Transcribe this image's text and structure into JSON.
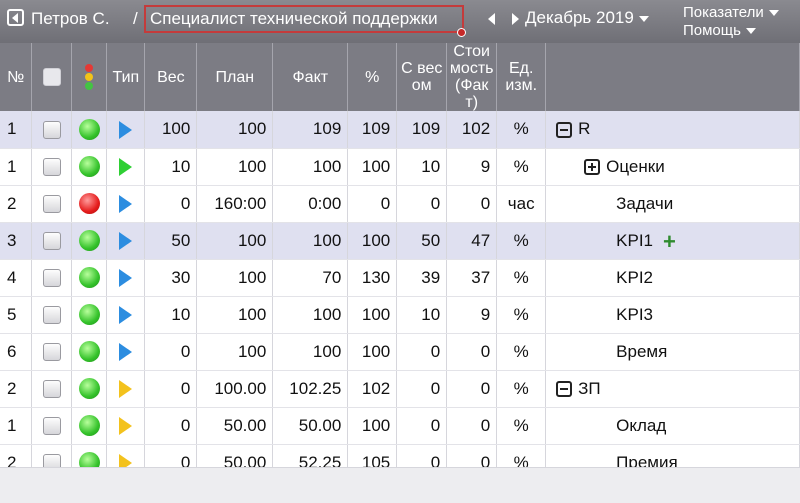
{
  "header": {
    "user": "Петров С.",
    "separator": "/",
    "role": "Специалист технической поддержки",
    "role_badge": "1",
    "period": "Декабрь 2019",
    "menu_indicators": "Показатели",
    "menu_help": "Помощь"
  },
  "columns": {
    "num": "№",
    "type": "Тип",
    "weight": "Вес",
    "plan": "План",
    "fact": "Факт",
    "pct": "%",
    "weighted": "С весом",
    "cost": "Стоимость (Факт)",
    "unit": "Ед. изм."
  },
  "rows": [
    {
      "num": "1",
      "status": "green",
      "type": "blue",
      "weight": "100",
      "plan": "100",
      "fact": "109",
      "pct": "109",
      "weighted": "109",
      "cost": "102",
      "unit": "%",
      "name": "R",
      "level": 0,
      "tree": "minus",
      "highlight": true
    },
    {
      "num": "1",
      "status": "green",
      "type": "green",
      "weight": "10",
      "plan": "100",
      "fact": "100",
      "pct": "100",
      "weighted": "10",
      "cost": "9",
      "unit": "%",
      "name": "Оценки",
      "level": 1,
      "tree": "plus"
    },
    {
      "num": "2",
      "status": "red",
      "type": "blue",
      "weight": "0",
      "plan": "160:00",
      "fact": "0:00",
      "pct": "0",
      "weighted": "0",
      "cost": "0",
      "unit": "час",
      "name": "Задачи",
      "level": 2
    },
    {
      "num": "3",
      "status": "green",
      "type": "blue",
      "weight": "50",
      "plan": "100",
      "fact": "100",
      "pct": "100",
      "weighted": "50",
      "cost": "47",
      "unit": "%",
      "name": "KPI1",
      "level": 2,
      "highlight": true,
      "add": true
    },
    {
      "num": "4",
      "status": "green",
      "type": "blue",
      "weight": "30",
      "plan": "100",
      "fact": "70",
      "pct": "130",
      "weighted": "39",
      "cost": "37",
      "unit": "%",
      "name": "KPI2",
      "level": 2
    },
    {
      "num": "5",
      "status": "green",
      "type": "blue",
      "weight": "10",
      "plan": "100",
      "fact": "100",
      "pct": "100",
      "weighted": "10",
      "cost": "9",
      "unit": "%",
      "name": "KPI3",
      "level": 2
    },
    {
      "num": "6",
      "status": "green",
      "type": "blue",
      "weight": "0",
      "plan": "100",
      "fact": "100",
      "pct": "100",
      "weighted": "0",
      "cost": "0",
      "unit": "%",
      "name": "Время",
      "level": 2
    },
    {
      "num": "2",
      "status": "green",
      "type": "yellow",
      "weight": "0",
      "plan": "100.00",
      "fact": "102.25",
      "pct": "102",
      "weighted": "0",
      "cost": "0",
      "unit": "%",
      "name": "ЗП",
      "level": 0,
      "tree": "minus"
    },
    {
      "num": "1",
      "status": "green",
      "type": "yellow",
      "weight": "0",
      "plan": "50.00",
      "fact": "50.00",
      "pct": "100",
      "weighted": "0",
      "cost": "0",
      "unit": "%",
      "name": "Оклад",
      "level": 2
    },
    {
      "num": "2",
      "status": "green",
      "type": "yellow",
      "weight": "0",
      "plan": "50.00",
      "fact": "52.25",
      "pct": "105",
      "weighted": "0",
      "cost": "0",
      "unit": "%",
      "name": "Премия",
      "level": 2
    }
  ]
}
